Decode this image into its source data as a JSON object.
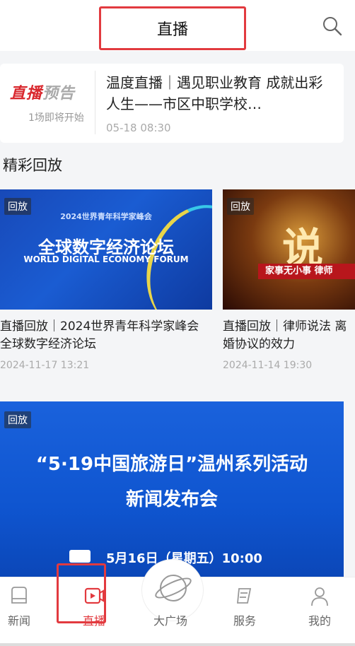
{
  "header": {
    "title": "直播"
  },
  "live_card": {
    "logo_text": "直播预告",
    "count_text": "1场即将开始",
    "title": "温度直播｜遇见职业教育  成就出彩人生——市区中职学校…",
    "time": "05-18  08:30"
  },
  "section": {
    "title": "精彩回放"
  },
  "replays": [
    {
      "badge": "回放",
      "image_text_top": "2024世界青年科学家峰会",
      "image_text_big": "全球数字经济论坛",
      "image_text_en": "WORLD DIGITAL ECONOMY FORUM",
      "title": "直播回放｜2024世界青年科学家峰会  全球数字经济论坛",
      "date": "2024-11-17  13:21"
    },
    {
      "badge": "回放",
      "image_text_big": "说",
      "image_text_banner": "家事无小事  律师",
      "title": "直播回放｜律师说法  离婚协议的效力",
      "date": "2024-11-14  19:30"
    }
  ],
  "banner": {
    "badge": "回放",
    "line1": "“5·19中国旅游日”温州系列活动",
    "line2": "新闻发布会",
    "date": "5月16日（星期五）10:00"
  },
  "tabbar": {
    "items": [
      {
        "label": "新闻",
        "icon": "news-icon"
      },
      {
        "label": "直播",
        "icon": "live-icon"
      },
      {
        "label": "大广场",
        "icon": "planet-icon"
      },
      {
        "label": "服务",
        "icon": "service-icon"
      },
      {
        "label": "我的",
        "icon": "profile-icon"
      }
    ],
    "active_index": 1
  },
  "colors": {
    "accent": "#e23a3f",
    "banner_blue": "#1a62dc"
  }
}
